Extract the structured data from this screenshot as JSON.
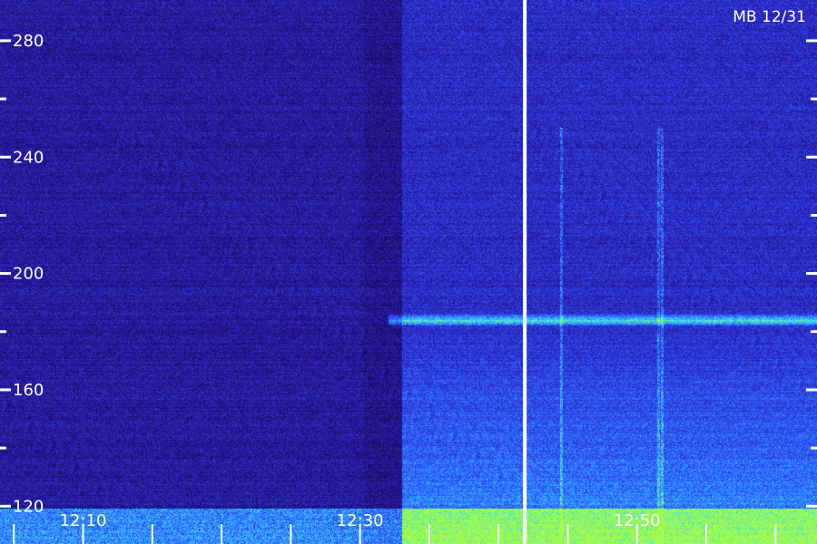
{
  "chart_data": {
    "type": "heatmap",
    "title": "",
    "stamp": "MB 12/31",
    "y_axis": {
      "range": [
        107,
        294
      ],
      "ticks": [
        280,
        240,
        200,
        160,
        120
      ],
      "minor_every": 20
    },
    "x_axis": {
      "range_minutes": [
        4,
        63
      ],
      "tick_labels": [
        {
          "label": "12:10",
          "minutes": 10
        },
        {
          "label": "12:30",
          "minutes": 30
        },
        {
          "label": "12:50",
          "minutes": 50
        }
      ],
      "minor_ticks_minutes": [
        5,
        10,
        15,
        20,
        25,
        30,
        35,
        40,
        45,
        50,
        55,
        60
      ]
    },
    "marker_line_minutes": 41.9,
    "features": {
      "horizontal_band_freq": 184,
      "band_start_minutes": 32,
      "activity_start_minutes": 33,
      "vertical_lines_minutes": [
        44.5,
        51.5,
        51.8
      ]
    },
    "colors": {
      "background": "#1c0f66",
      "low": "#2a1aa8",
      "mid": "#2f56ff",
      "high": "#35d8ff",
      "peak": "#aaff3a",
      "text": "#ffffff"
    }
  }
}
